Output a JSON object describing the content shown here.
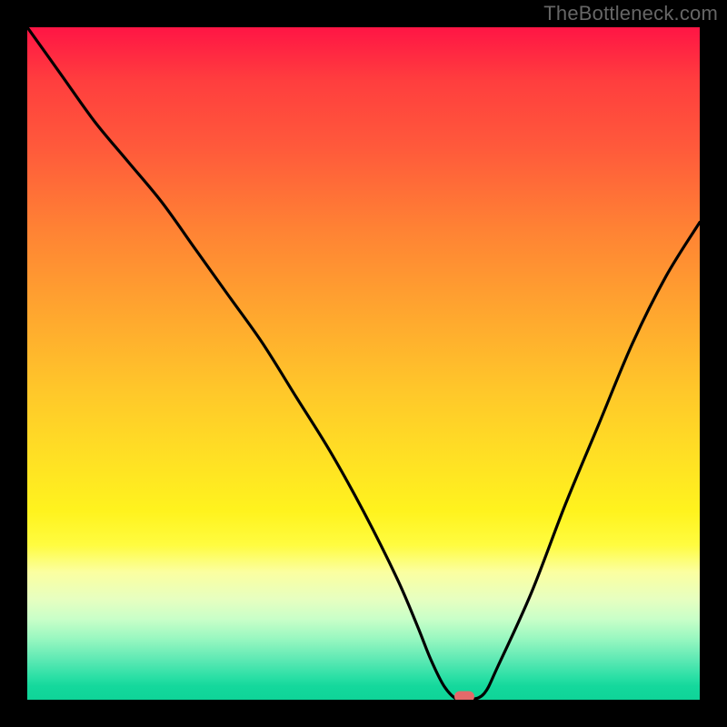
{
  "watermark": "TheBottleneck.com",
  "colors": {
    "curve": "#000000",
    "marker": "#e46a6a",
    "background_frame": "#000000"
  },
  "chart_data": {
    "type": "line",
    "title": "",
    "xlabel": "",
    "ylabel": "",
    "xlim": [
      0,
      100
    ],
    "ylim": [
      0,
      100
    ],
    "grid": false,
    "legend": null,
    "note": "Vertical axis is bottleneck percentage (red = 100%, green = 0%). The curve dips to ~0 at x≈65, indicating the balanced point; a small red marker highlights the minimum.",
    "series": [
      {
        "name": "bottleneck_pct",
        "x": [
          0,
          5,
          10,
          15,
          20,
          25,
          30,
          35,
          40,
          45,
          50,
          55,
          58,
          60,
          62,
          64,
          66,
          68,
          70,
          75,
          80,
          85,
          90,
          95,
          100
        ],
        "y": [
          100,
          93,
          86,
          80,
          74,
          67,
          60,
          53,
          45,
          37,
          28,
          18,
          11,
          6,
          2,
          0,
          0,
          1,
          5,
          16,
          29,
          41,
          53,
          63,
          71
        ]
      }
    ],
    "marker": {
      "x": 65,
      "y": 0.2
    }
  }
}
